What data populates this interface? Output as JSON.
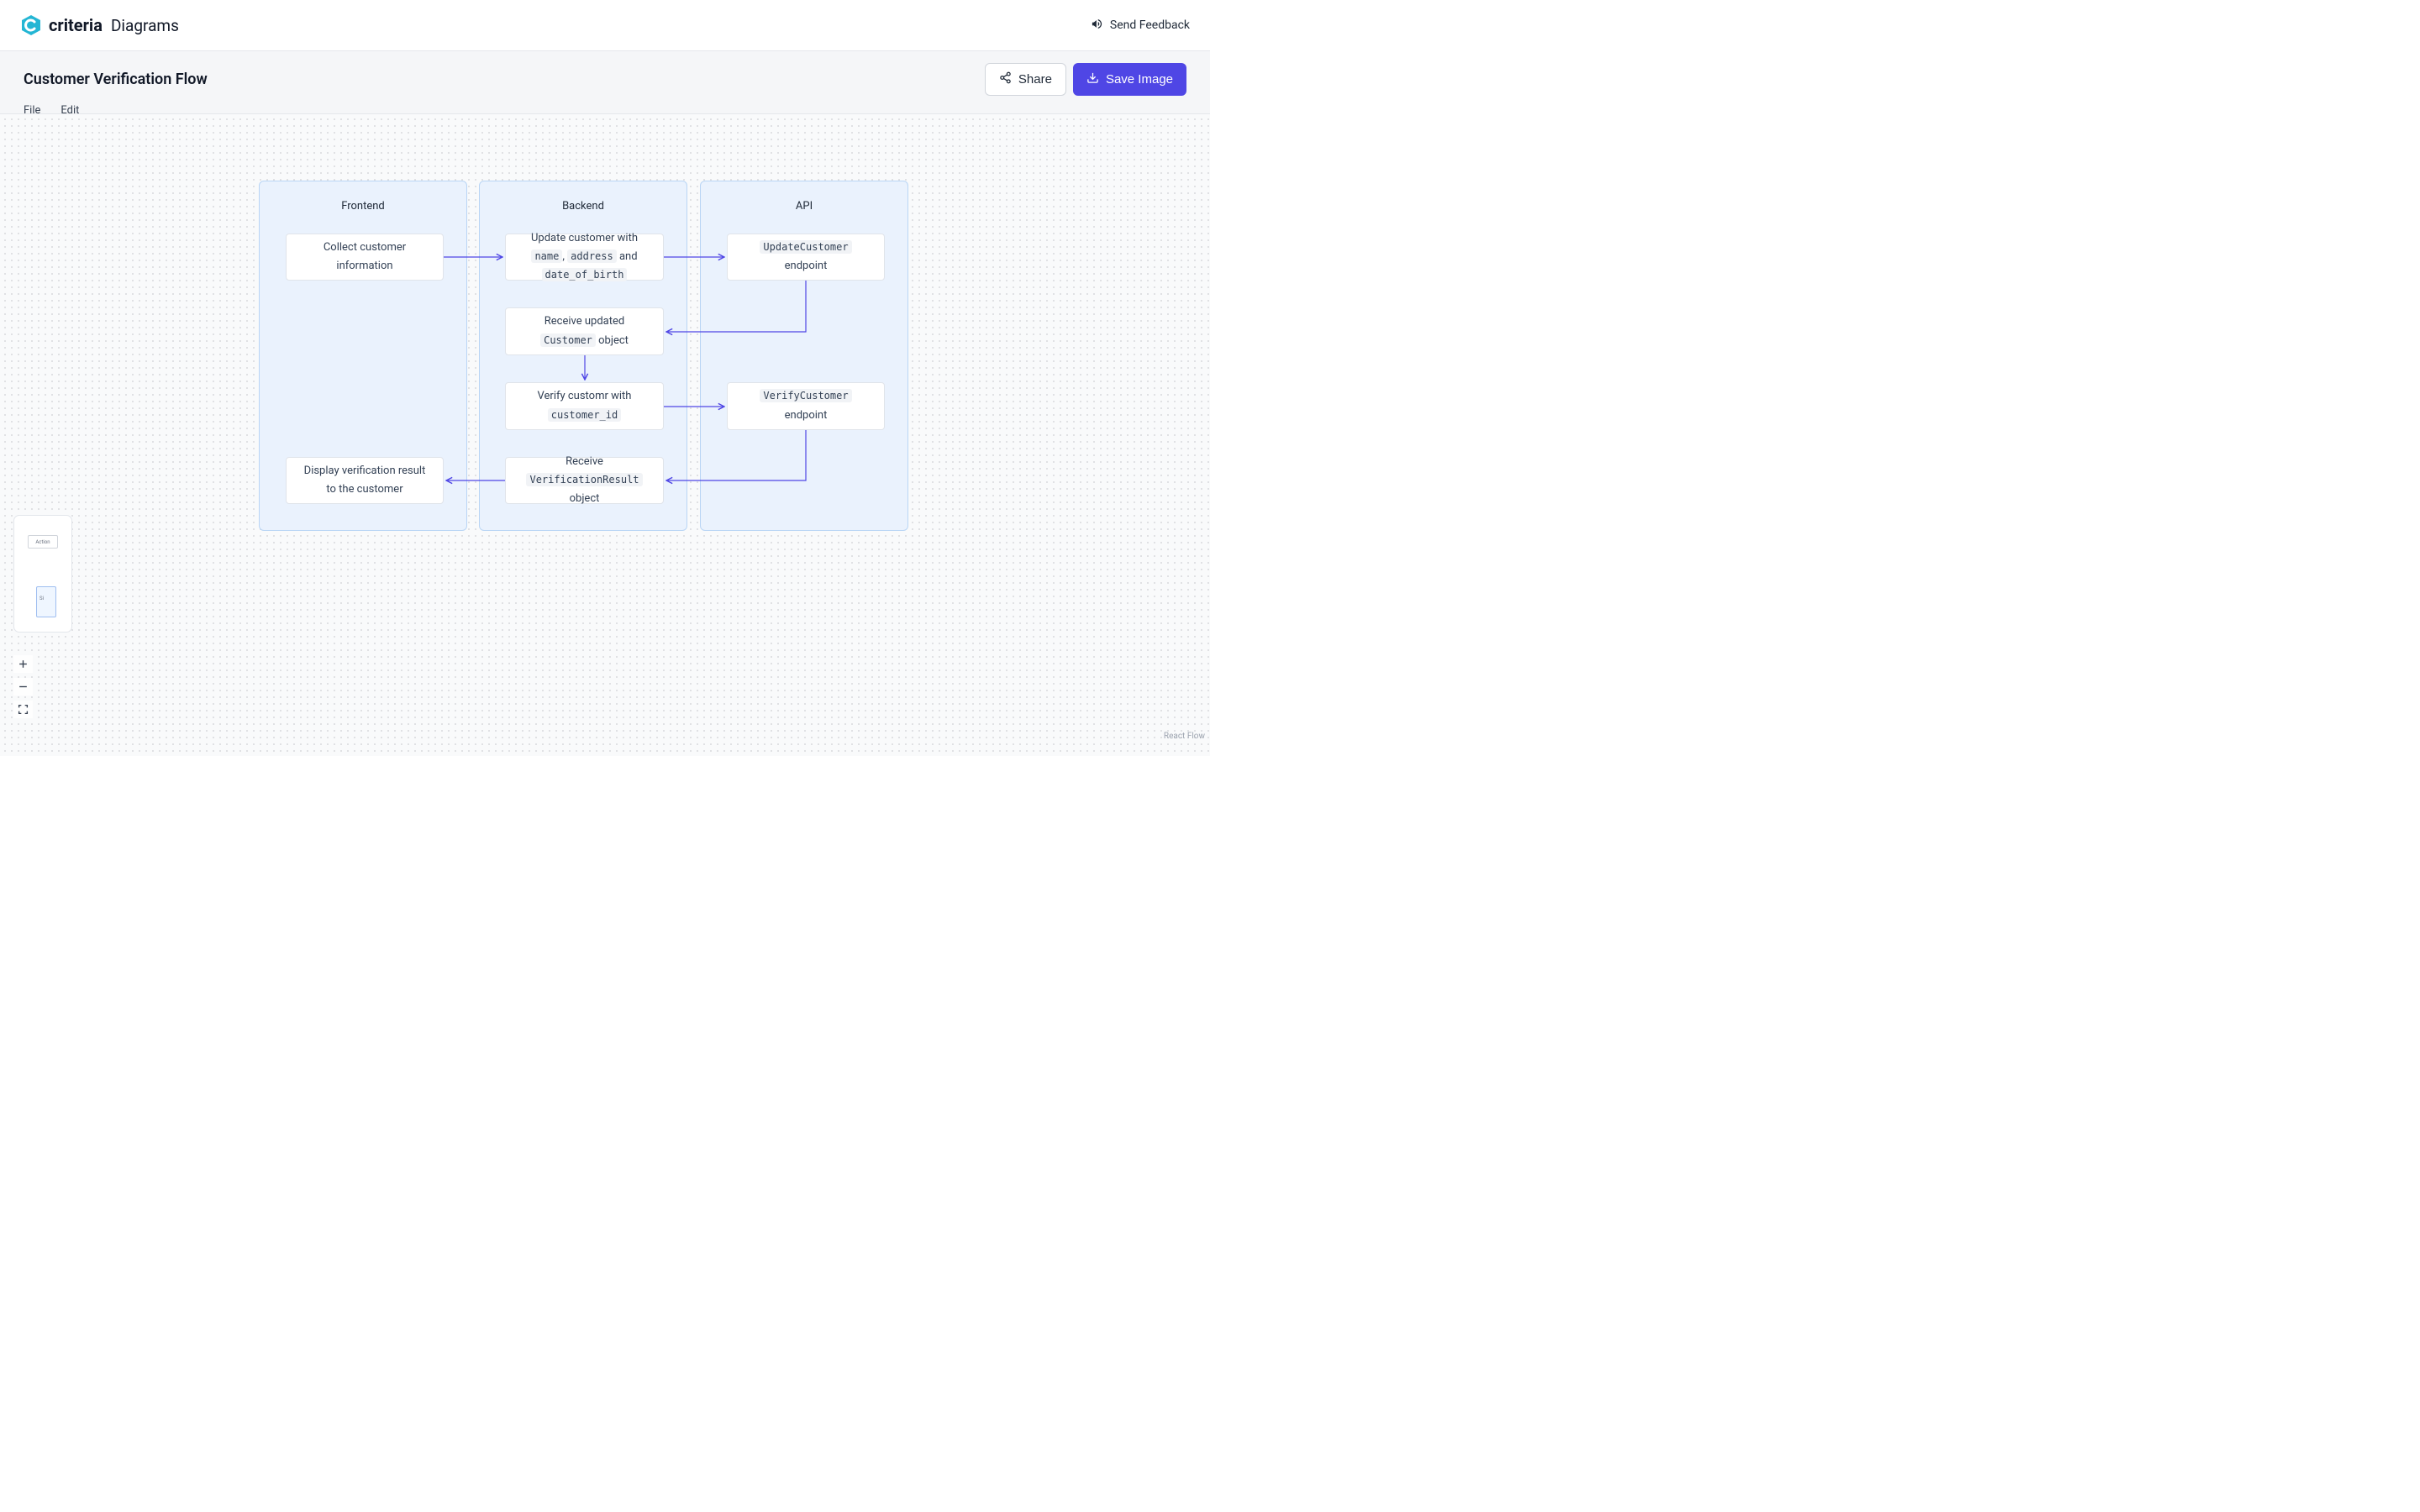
{
  "header": {
    "brand": "criteria",
    "product": "Diagrams",
    "feedback_label": "Send Feedback"
  },
  "toolbar": {
    "title": "Customer Verification Flow",
    "share_label": "Share",
    "save_label": "Save Image",
    "menu": {
      "file": "File",
      "edit": "Edit"
    }
  },
  "lanes": {
    "frontend": "Frontend",
    "backend": "Backend",
    "api": "API"
  },
  "nodes": {
    "collect": "Collect customer information",
    "update_prefix": "Update customer with ",
    "update_code1": "name",
    "update_mid1": ", ",
    "update_code2": "address",
    "update_mid2": " and ",
    "update_code3": "date_of_birth",
    "endpoint1_code": "UpdateCustomer",
    "endpoint1_suffix": " endpoint",
    "receive_cust_prefix": "Receive updated ",
    "receive_cust_code": "Customer",
    "receive_cust_suffix": " object",
    "verify_prefix": "Verify customr with ",
    "verify_code": "customer_id",
    "endpoint2_code": "VerifyCustomer",
    "endpoint2_suffix": " endpoint",
    "receive_vr_prefix": "Receive ",
    "receive_vr_code": "VerificationResult",
    "receive_vr_suffix": " object",
    "display": "Display verification result to the customer"
  },
  "minimap": {
    "label1": "Action",
    "label2": "Si"
  },
  "attribution": "React Flow"
}
